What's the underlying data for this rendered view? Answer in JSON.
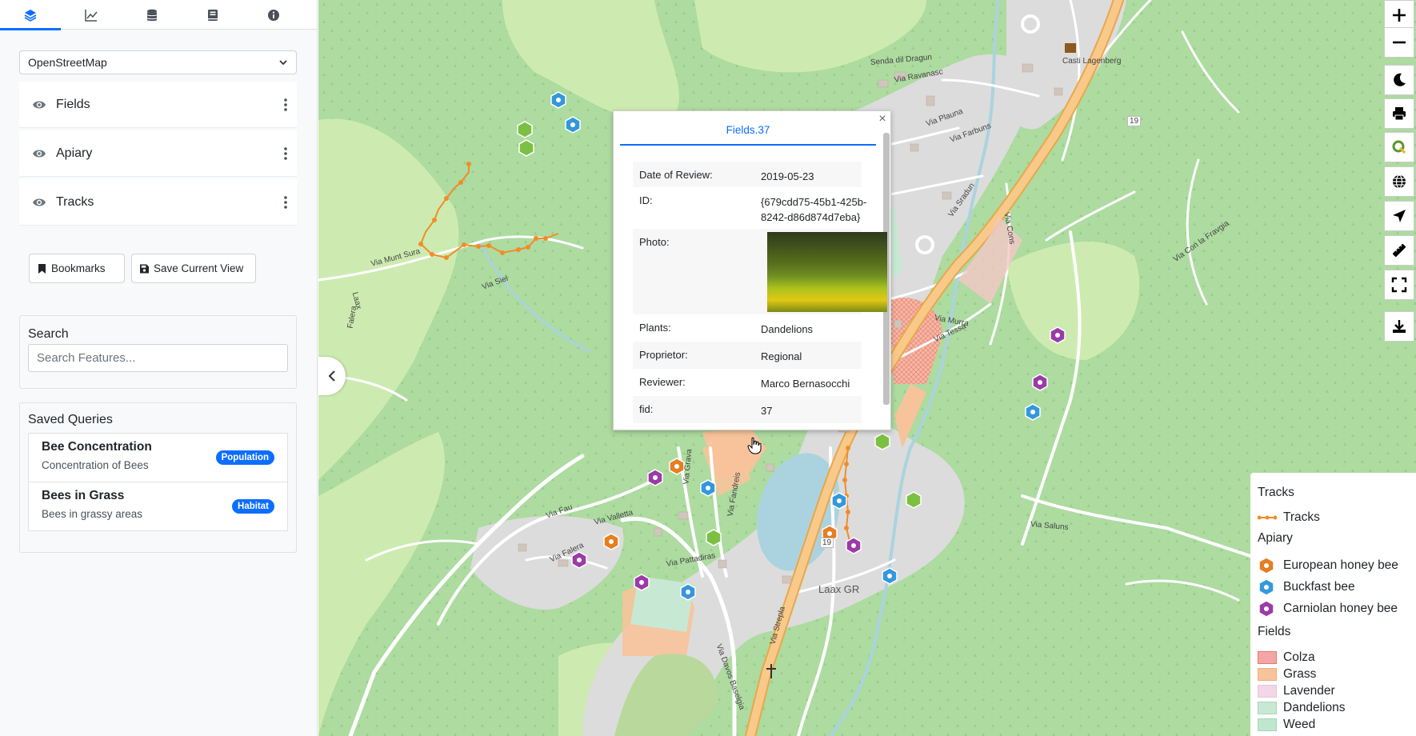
{
  "sidebar": {
    "tabs": [
      {
        "icon": "layers-icon",
        "active": true
      },
      {
        "icon": "chart-icon",
        "active": false
      },
      {
        "icon": "database-icon",
        "active": false
      },
      {
        "icon": "book-icon",
        "active": false
      },
      {
        "icon": "info-icon",
        "active": false
      }
    ],
    "basemap": "OpenStreetMap",
    "layers": [
      {
        "label": "Fields"
      },
      {
        "label": "Apiary"
      },
      {
        "label": "Tracks"
      }
    ],
    "bookmarks_label": "Bookmarks",
    "save_view_label": "Save Current View",
    "search": {
      "title": "Search",
      "placeholder": "Search Features..."
    },
    "saved_queries": {
      "title": "Saved Queries",
      "items": [
        {
          "title": "Bee Concentration",
          "subtitle": "Concentration of Bees",
          "badge": "Population"
        },
        {
          "title": "Bees in Grass",
          "subtitle": "Bees in grassy areas",
          "badge": "Habitat"
        }
      ]
    }
  },
  "popup": {
    "title": "Fields.37",
    "rows": [
      {
        "key": "Date of Review:",
        "value": "2019-05-23"
      },
      {
        "key": "ID:",
        "value": "{679cdd75-45b1-425b-8242-d86d874d7eba}"
      },
      {
        "key": "Photo:",
        "value": ""
      },
      {
        "key": "Plants:",
        "value": "Dandelions"
      },
      {
        "key": "Proprietor:",
        "value": "Regional"
      },
      {
        "key": "Reviewer:",
        "value": "Marco Bernasocchi"
      },
      {
        "key": "fid:",
        "value": "37"
      }
    ]
  },
  "map": {
    "labels": [
      {
        "text": "Senda dil Dragun"
      },
      {
        "text": "Via Ravanasc"
      },
      {
        "text": "Casti Lagenberg"
      },
      {
        "text": "Via Sradun"
      },
      {
        "text": "Via Saluns"
      },
      {
        "text": "Via Con la Fravgia"
      },
      {
        "text": "Via Munt Sura"
      },
      {
        "text": "Via Siel"
      },
      {
        "text": "Via Falera"
      },
      {
        "text": "Via Pattadiras"
      },
      {
        "text": "Via Valletta"
      },
      {
        "text": "Via Fau"
      },
      {
        "text": "Laax GR"
      },
      {
        "text": "Via Plauna"
      },
      {
        "text": "Via Farbuns"
      },
      {
        "text": "Via Murra"
      },
      {
        "text": "Via Tessa"
      },
      {
        "text": "Laax"
      },
      {
        "text": "Falera"
      },
      {
        "text": "Via Grava"
      },
      {
        "text": "Via Fandreis"
      },
      {
        "text": "Via Strepla"
      },
      {
        "text": "Via Davos Baselgia"
      },
      {
        "text": "Via Cons"
      },
      {
        "text": "19"
      }
    ]
  },
  "legend": {
    "tracks_header": "Tracks",
    "tracks_item": "Tracks",
    "apiary_header": "Apiary",
    "apiary_items": [
      {
        "label": "European honey bee",
        "color": "#e67e22"
      },
      {
        "label": "Buckfast bee",
        "color": "#3498db"
      },
      {
        "label": "Carniolan honey bee",
        "color": "#9b3ba6"
      }
    ],
    "fields_header": "Fields",
    "fields_items": [
      {
        "label": "Colza",
        "color": "#f4a6a6"
      },
      {
        "label": "Grass",
        "color": "#f7c39a"
      },
      {
        "label": "Lavender",
        "color": "#f2d8e6"
      },
      {
        "label": "Dandelions",
        "color": "#c7e8d3"
      },
      {
        "label": "Weed",
        "color": "#bfe6cf"
      }
    ]
  },
  "colors": {
    "accent": "#0d6efd",
    "track": "#f28c28",
    "forest": "#addba0",
    "meadow": "#cdebb0",
    "urban": "#dcdcdc",
    "road": "#ffffff",
    "main_road": "#f7b96b"
  }
}
